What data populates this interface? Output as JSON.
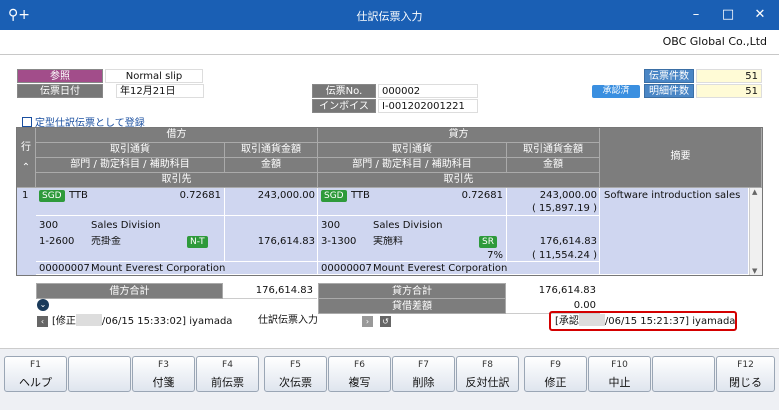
{
  "window": {
    "title": "仕訳伝票入力",
    "minimize": "–",
    "maximize": "□",
    "close": "✕"
  },
  "company": "OBC Global Co.,Ltd",
  "header": {
    "ref_label": "参照",
    "ref_value": "Normal slip",
    "date_label": "伝票日付",
    "date_value": "年12月21日",
    "slip_no_label": "伝票No.",
    "slip_no_value": "000002",
    "invoice_no_label": "インボイスNo.",
    "invoice_no_value": "I-001202001221",
    "slip_count_label": "伝票件数",
    "slip_count_value": "51",
    "status_badge": "承認済",
    "detail_count_label": "明細件数",
    "detail_count_value": "51"
  },
  "register_link": "定型仕訳伝票として登録",
  "table": {
    "row_label": "行",
    "debit": "借方",
    "credit": "貸方",
    "currency": "取引通貨",
    "currency_amount": "取引通貨金額",
    "dept_account": "部門 / 勘定科目 / 補助科目",
    "amount": "金額",
    "partner": "取引先",
    "summary": "摘要",
    "rows": [
      {
        "no": "1",
        "debit": {
          "currency": "SGD",
          "rate_type": "TTB",
          "rate": "0.72681",
          "fx_amount": "243,000.00",
          "dept_code": "300",
          "dept_name": "Sales Division",
          "account_code": "1-2600",
          "account_name": "売掛金",
          "tax": "N-T",
          "amount": "176,614.83",
          "partner_code": "00000007",
          "partner_name": "Mount Everest Corporation"
        },
        "credit": {
          "currency": "SGD",
          "rate_type": "TTB",
          "rate": "0.72681",
          "fx_amount": "243,000.00",
          "fx_tax": "( 15,897.19 )",
          "dept_code": "300",
          "dept_name": "Sales Division",
          "account_code": "3-1300",
          "account_name": "実施料",
          "tax": "SR",
          "amount": "176,614.83",
          "tax_rate": "7%",
          "tax_amount": "( 11,554.24 )",
          "partner_code": "00000007",
          "partner_name": "Mount Everest Corporation"
        },
        "summary": "Software introduction sales"
      }
    ]
  },
  "totals": {
    "debit_total_label": "借方合計",
    "debit_total": "176,614.83",
    "credit_total_label": "貸方合計",
    "credit_total": "176,614.83",
    "diff_label": "貸借差額",
    "diff": "0.00"
  },
  "footer": {
    "modified": "[修正",
    "modified_time": "/06/15 15:33:02] iyamada",
    "screen_name": "仕訳伝票入力",
    "approved": "[承認",
    "approved_time": "/06/15 15:21:37] iyamada"
  },
  "fkeys": [
    {
      "key": "F1",
      "label": "ヘルプ"
    },
    {
      "key": "",
      "label": ""
    },
    {
      "key": "F3",
      "label": "付箋"
    },
    {
      "key": "F4",
      "label": "前伝票"
    },
    {
      "key": "F5",
      "label": "次伝票"
    },
    {
      "key": "F6",
      "label": "複写"
    },
    {
      "key": "F7",
      "label": "削除"
    },
    {
      "key": "F8",
      "label": "反対仕訳"
    },
    {
      "key": "F9",
      "label": "修正"
    },
    {
      "key": "F10",
      "label": "中止"
    },
    {
      "key": "",
      "label": ""
    },
    {
      "key": "F12",
      "label": "閉じる"
    }
  ]
}
